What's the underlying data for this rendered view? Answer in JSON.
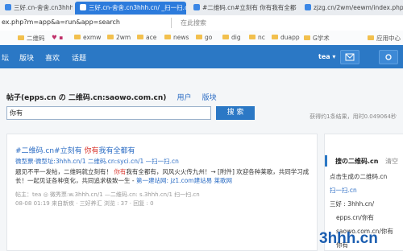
{
  "browser": {
    "tabs": [
      {
        "label": "三好.cn-舍舍.cn3hhh.cn"
      },
      {
        "label": "三好.cn-舍舍.cn3hhh.cn/ _扫一扫.cn"
      },
      {
        "label": "#二维码.cn#立刻有 你有我有全都有"
      },
      {
        "label": "zjzg.cn/2wm/eewm/index.php?s"
      }
    ],
    "tab_close": "×",
    "address": "ex.php?m=app&a=run&app=search",
    "address_search_placeholder": "在此搜索",
    "bookmarks": [
      "二维码",
      "♥ ▪",
      "exmw",
      "2wm",
      "ace",
      "news",
      "go",
      "dig",
      "nc",
      "duapp",
      "G学术",
      "应用中心"
    ]
  },
  "nav": {
    "items": [
      "坛",
      "版块",
      "喜欢",
      "话题"
    ],
    "user": "tea ▾"
  },
  "search": {
    "title": "帖子(epps.cn の 二维码.cn:saowo.com.cn)",
    "link_user": "用户",
    "link_board": "版块",
    "query": "你有",
    "button": "搜 索",
    "result_count": "获得约1条结果，用时0.049064秒"
  },
  "result": {
    "title_a": "#二维码.cn#立刻有 ",
    "title_hl": "你有",
    "title_b": "我有全都有",
    "meta": "微型票·微型址:3hhh.cn/1 二维码.cn:syci.cn/1 —扫一扫.cn",
    "body1_a": "题见不平一发帖，二维码就立刻有！ ",
    "body1_hl": "你有",
    "body1_b": "我有全都有，风风火火传九州！→ [附件] 欢迎各种莱歌，共同学习成",
    "body2_a": "长！一起见证各种变化，共同追求极致一生 - ",
    "body2_link": "第一建站网: jz1.com建站易 莱歌网",
    "foot1": "帖主：tea  ◎ 微秀票:w.3hhh.cn/1  —二维码.cn: s.3hhh.cn/1  扫一扫.cn",
    "foot2": "08-08 01:19    来自新疾 · 三好养汇    浏览 : 37 · 回复 : 0"
  },
  "sidebar": {
    "tab_active": "搜の二维码.cn",
    "tab_other": "清空",
    "items": [
      "点击生成の二维码.cn",
      "扫一扫.cn",
      "三好 : 3hhh.cn/",
      "epps.cn/你有",
      "saowo.com.cn/你有",
      "你有"
    ]
  },
  "watermark": "3hhh.cn",
  "colors": {
    "nav": "#2b78c5",
    "link": "#2b6cc4",
    "highlight": "#d9342b"
  }
}
